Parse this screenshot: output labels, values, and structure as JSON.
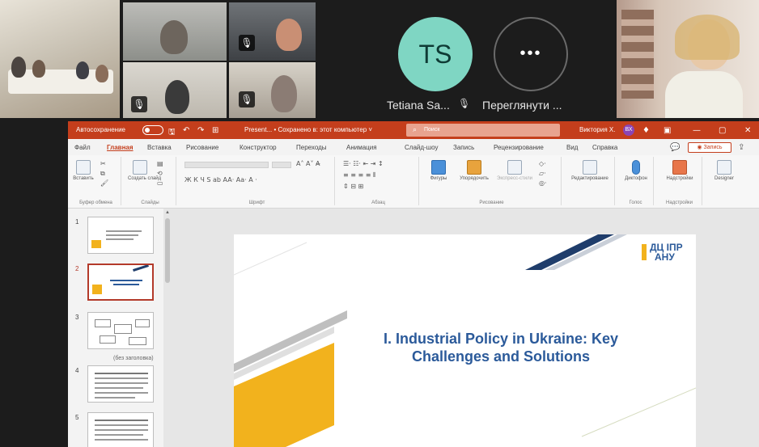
{
  "meeting": {
    "participant_ts": {
      "initials": "TS",
      "name": "Tetiana Sa..."
    },
    "more": {
      "glyph": "•••",
      "label": "Переглянути ..."
    },
    "mute_glyph": "🎙"
  },
  "ppt": {
    "titlebar": {
      "autosave": "Автосохранение",
      "filename": "Present... • Сохранено в: этот компьютер ˅",
      "search": "Поиск",
      "user": "Виктория Х.",
      "user_initials": "ВХ",
      "min": "—",
      "max": "▢",
      "close": "✕"
    },
    "menu": [
      "Файл",
      "Главная",
      "Вставка",
      "Рисование",
      "Конструктор",
      "Переходы",
      "Анимация",
      "Слайд-шоу",
      "Запись",
      "Рецензирование",
      "Вид",
      "Справка"
    ],
    "record_button": "◉ Запись",
    "ribbon": {
      "groups": [
        "Буфер обмена",
        "Слайды",
        "Шрифт",
        "Абзац",
        "Рисование",
        "Голос",
        "Надстройки"
      ],
      "buttons": {
        "paste": "Вставить",
        "new_slide": "Создать слайд",
        "shapes": "Фигуры",
        "arrange": "Упорядочить",
        "quick_styles": "Экспресс-стили",
        "editing": "Редактирование",
        "dictate": "Диктофон",
        "addins": "Надстройки",
        "designer": "Designer"
      },
      "font_glyphs": "Ж К Ч S ab AA· Aa· A ·"
    },
    "thumbnails": {
      "numbers": [
        "1",
        "2",
        "3",
        "4",
        "5"
      ],
      "untitled_note": "(без заголовка)"
    },
    "slide": {
      "title_line1": "I.  Industrial Policy in Ukraine: Key",
      "title_line2": "Challenges and Solutions",
      "logo_top": "ДЦ ІПР",
      "logo_bottom": "АНУ"
    }
  }
}
